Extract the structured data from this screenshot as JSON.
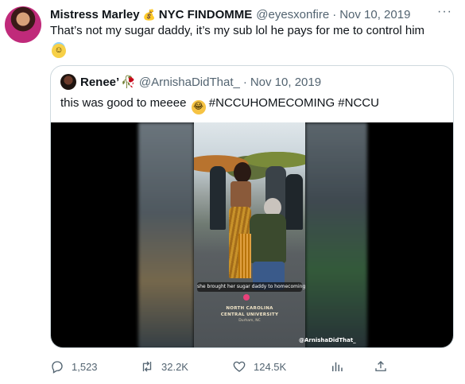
{
  "tweet": {
    "author_name": "Mistress Marley",
    "author_badge_icon": "money-bag-icon",
    "author_title": "NYC FINDOMME",
    "handle": "@eyesxonfire",
    "separator": "·",
    "date": "Nov 10, 2019",
    "more_label": "···",
    "text": "That’s not my sugar daddy, it’s my sub lol he pays for me to control him",
    "text_emoji": "smiling-face-with-halo"
  },
  "quote": {
    "author_name": "Renee’",
    "author_emoji": "wilted-rose-icon",
    "handle": "@ArnishaDidThat_",
    "separator": "·",
    "date": "Nov 10, 2019",
    "text": "this was good to meeee",
    "text_emoji": "rolling-on-floor-laughing",
    "hashtags": "#NCCUHOMECOMING #NCCU",
    "video": {
      "caption": "she brought her sugar daddy to homecoming",
      "logo_line1": "NORTH CAROLINA",
      "logo_line2": "CENTRAL UNIVERSITY",
      "logo_line3": "Durham, NC",
      "watermark": "@ArnishaDidThat_"
    }
  },
  "actions": {
    "replies": "1,523",
    "retweets": "32.2K",
    "likes": "124.5K"
  },
  "colors": {
    "text": "#0f1419",
    "muted": "#536471",
    "border": "#cfd9de"
  }
}
